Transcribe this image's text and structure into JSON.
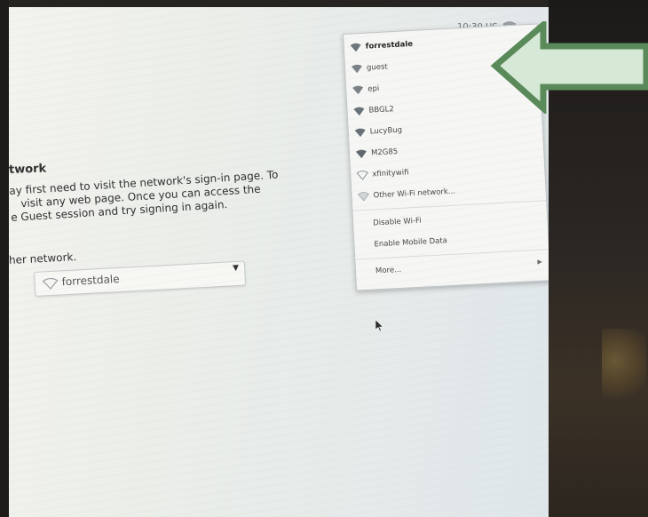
{
  "status_bar": {
    "clock": "10:30 US",
    "wifi_icon": "wifi-signal-icon"
  },
  "page": {
    "heading": "twork",
    "paragraph_lines": [
      "ay first need to visit the network's sign-in page. To",
      "visit any web page. Once you can access the",
      "e Guest session and try signing in again."
    ],
    "subheading": "her network.",
    "network_select": {
      "selected": "forrestdale",
      "icon": "wifi-signal-icon",
      "chevron_icon": "chevron-down-icon"
    }
  },
  "wifi_menu": {
    "networks": [
      {
        "name": "forrestdale",
        "bold": true
      },
      {
        "name": "guest",
        "bold": false
      },
      {
        "name": "epi",
        "bold": false
      },
      {
        "name": "BBGL2",
        "bold": false
      },
      {
        "name": "LucyBug",
        "bold": false
      },
      {
        "name": "M2G85",
        "bold": false
      },
      {
        "name": "xfinitywifi",
        "bold": false
      }
    ],
    "other_network": "Other Wi-Fi network...",
    "disable_wifi": "Disable Wi-Fi",
    "enable_mobile": "Enable Mobile Data",
    "more": "More...",
    "more_arrow_icon": "chevron-right-icon"
  },
  "overlay": {
    "arrow_icon": "green-arrow-left-icon",
    "arrow_fill": "#d6e8d6",
    "arrow_stroke": "#5a8a5a"
  },
  "colors": {
    "screen_bg": "#eceee9",
    "menu_bg": "#f6f7f5",
    "bezel": "#2a2420"
  }
}
